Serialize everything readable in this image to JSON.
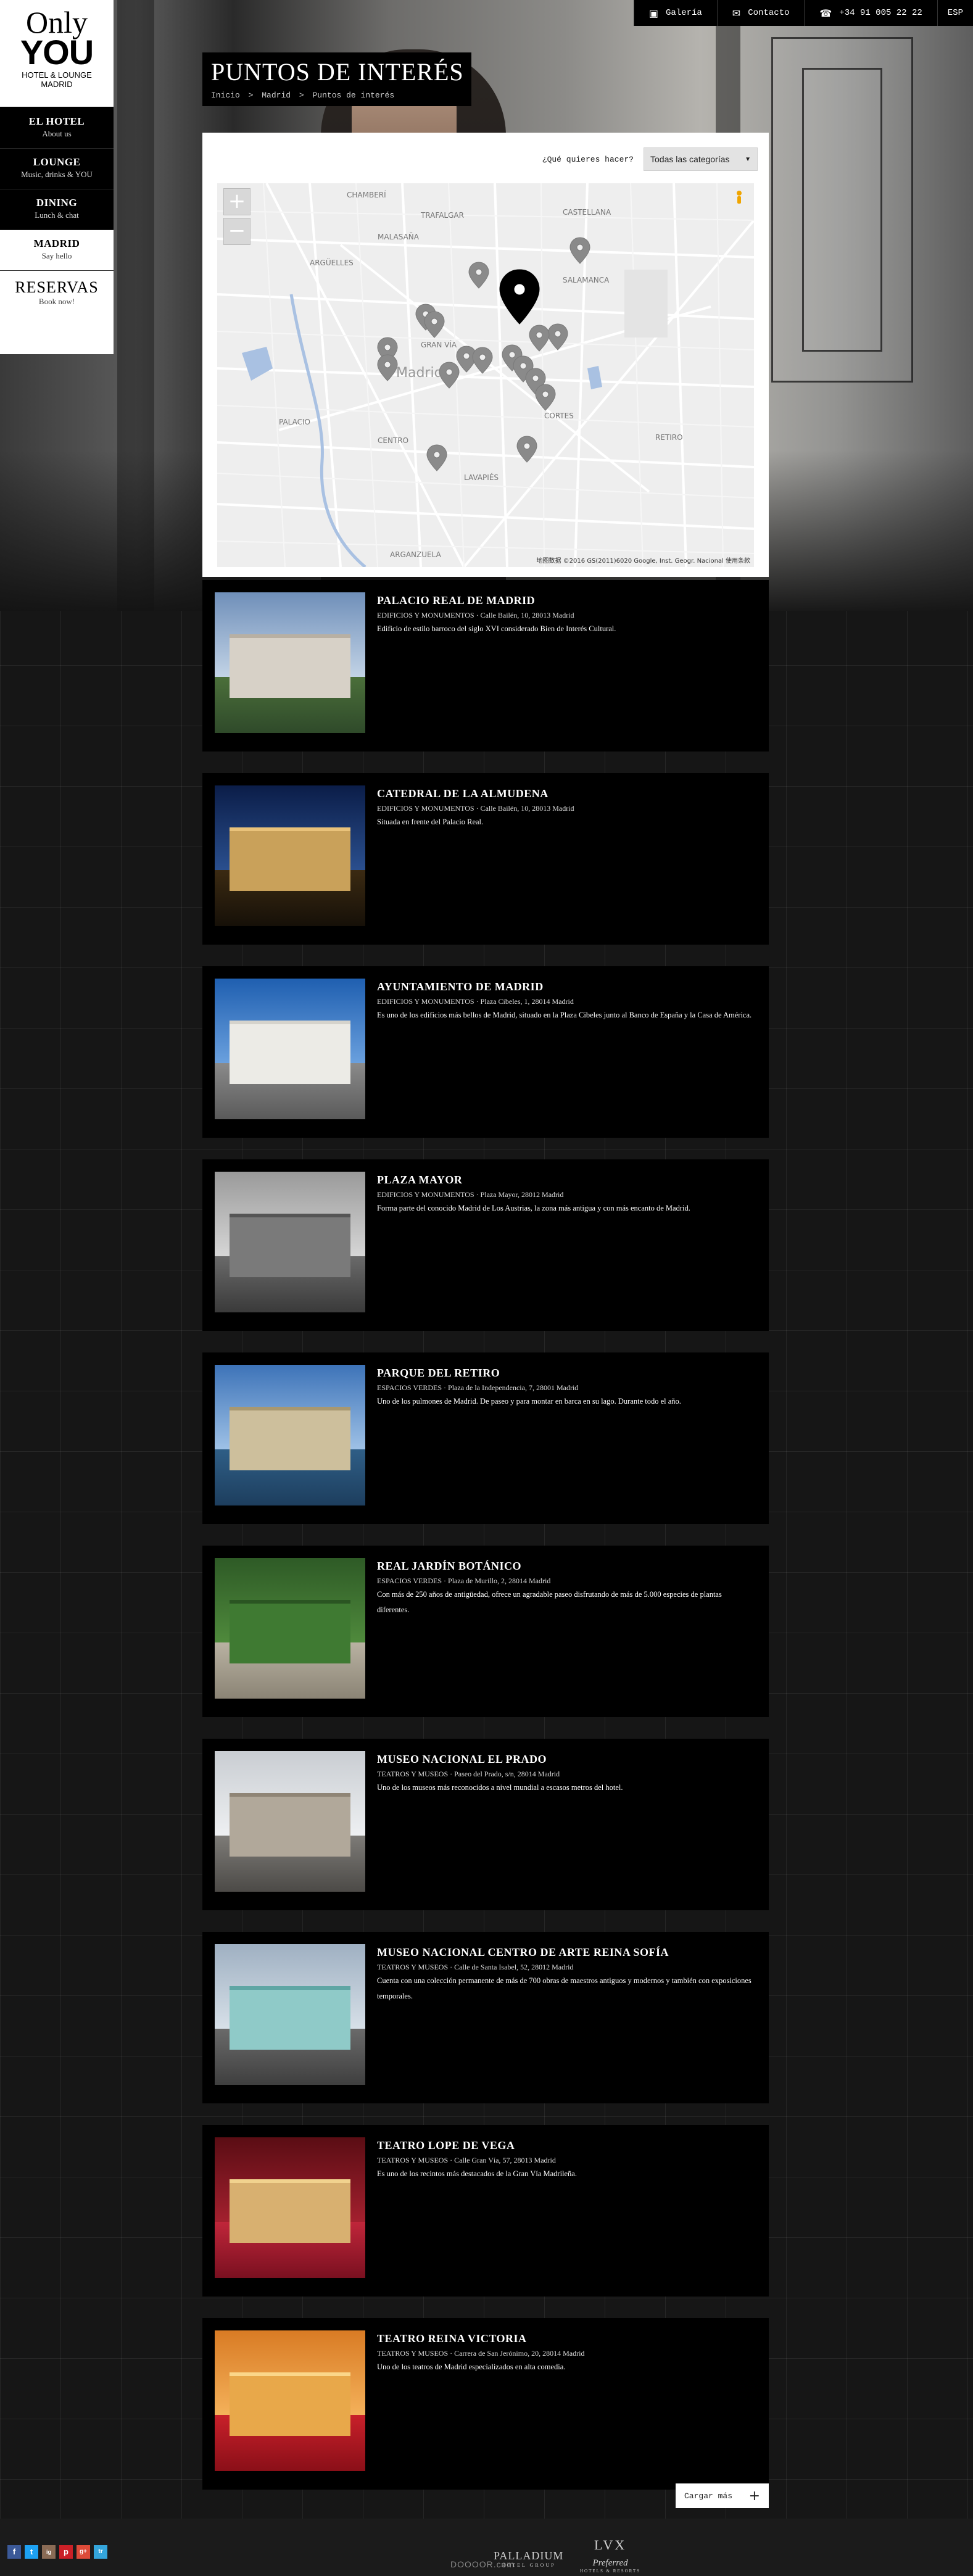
{
  "logo": {
    "line1": "Only",
    "line2": "YOU",
    "line3": "HOTEL & LOUNGE",
    "line4": "MADRID"
  },
  "nav": [
    {
      "title": "EL HOTEL",
      "sub": "About us",
      "active": false
    },
    {
      "title": "LOUNGE",
      "sub": "Music, drinks & YOU",
      "active": false
    },
    {
      "title": "DINING",
      "sub": "Lunch & chat",
      "active": false
    },
    {
      "title": "MADRID",
      "sub": "Say hello",
      "active": true
    }
  ],
  "reservas": {
    "title": "RESERVAS",
    "sub": "Book now!"
  },
  "topbar": {
    "gallery": {
      "icon": "camera-icon",
      "label": "Galería"
    },
    "contact": {
      "icon": "envelope-icon",
      "label": "Contacto"
    },
    "phone": {
      "icon": "phone-icon",
      "label": "+34 91 005 22 22"
    },
    "lang": "ESP"
  },
  "page": {
    "title": "PUNTOS DE INTERÉS",
    "breadcrumb": [
      "Inicio",
      ">",
      "Madrid",
      ">",
      "Puntos de interés"
    ]
  },
  "map_filter": {
    "label": "¿Qué quieres hacer?",
    "selected": "Todas las categorías",
    "arrow": "▼"
  },
  "map": {
    "zoom_in": "+",
    "zoom_out": "−",
    "credit": "地图数据 ©2016 GS(2011)6020 Google, Inst. Geogr. Nacional   使用条款",
    "labels": {
      "chamberi": "CHAMBERÍ",
      "malasana": "MALASAÑA",
      "salamanca": "SALAMANCA",
      "castellana": "CASTELLANA",
      "gran_via": "GRAN VÍA",
      "madrid": "Madrid",
      "centro": "CENTRO",
      "retiro": "RETIRO",
      "cortes": "CORTES",
      "lavapies": "LAVAPIÉS",
      "arganzuela": "ARGANZUELA",
      "palacio": "PALACIO",
      "trafalgar": "TRAFALGAR",
      "arguelles": "ARGÜELLES"
    }
  },
  "poi": [
    {
      "title": "PALACIO REAL DE MADRID",
      "meta": "EDIFICIOS Y MONUMENTOS · Calle Bailén, 10, 28013 Madrid",
      "desc": "Edificio de estilo barroco del siglo XVI considerado Bien de Interés Cultural."
    },
    {
      "title": "CATEDRAL DE LA ALMUDENA",
      "meta": "EDIFICIOS Y MONUMENTOS · Calle Bailén, 10, 28013 Madrid",
      "desc": "Situada en frente del Palacio Real."
    },
    {
      "title": "AYUNTAMIENTO DE MADRID",
      "meta": "EDIFICIOS Y MONUMENTOS · Plaza Cibeles, 1, 28014 Madrid",
      "desc": "Es uno de los edificios más bellos de Madrid, situado en la Plaza Cibeles junto al Banco de España y la Casa de América."
    },
    {
      "title": "PLAZA MAYOR",
      "meta": "EDIFICIOS Y MONUMENTOS · Plaza Mayor, 28012 Madrid",
      "desc": "Forma parte del conocido Madrid de Los Austrias, la zona más antigua y con más encanto de Madrid."
    },
    {
      "title": "PARQUE DEL RETIRO",
      "meta": "ESPACIOS VERDES · Plaza de la Independencia, 7, 28001 Madrid",
      "desc": "Uno de los pulmones de Madrid. De paseo y para montar en barca en su lago. Durante todo el año."
    },
    {
      "title": "REAL JARDÍN BOTÁNICO",
      "meta": "ESPACIOS VERDES · Plaza de Murillo, 2, 28014 Madrid",
      "desc": "Con más de 250 años de antigüedad, ofrece un agradable paseo disfrutando de más de 5.000 especies de plantas diferentes."
    },
    {
      "title": "MUSEO NACIONAL EL PRADO",
      "meta": "TEATROS Y MUSEOS · Paseo del Prado, s/n, 28014 Madrid",
      "desc": "Uno de los museos más reconocidos a nivel mundial a escasos metros del hotel."
    },
    {
      "title": "MUSEO NACIONAL CENTRO DE ARTE REINA SOFÍA",
      "meta": "TEATROS Y MUSEOS · Calle de Santa Isabel, 52, 28012 Madrid",
      "desc": "Cuenta con una colección permanente de más de 700 obras de maestros antiguos y modernos y también con exposiciones temporales."
    },
    {
      "title": "TEATRO LOPE DE VEGA",
      "meta": "TEATROS Y MUSEOS · Calle Gran Vía, 57, 28013 Madrid",
      "desc": "Es uno de los recintos más destacados de la Gran Vía Madrileña."
    },
    {
      "title": "TEATRO REINA VICTORIA",
      "meta": "TEATROS Y MUSEOS · Carrera de San Jerónimo, 20, 28014 Madrid",
      "desc": "Uno de los teatros de Madrid especializados en alta comedia."
    }
  ],
  "load_more": {
    "label": "Cargar más",
    "icon": "+"
  },
  "footer": {
    "socials": [
      "f",
      "t",
      "ig",
      "p",
      "g+",
      "tr"
    ],
    "brand1": {
      "name": "PALLADIUM",
      "sub": "HOTEL GROUP"
    },
    "brand2": {
      "name": "LVX",
      "script": "Preferred",
      "sub": "HOTELS & RESORTS"
    },
    "watermark": "DOOOOR.com"
  },
  "colors": {
    "panel": "#000000",
    "accent": "#ffffff",
    "pin": "#8a8a8a",
    "pin_main": "#000000"
  }
}
